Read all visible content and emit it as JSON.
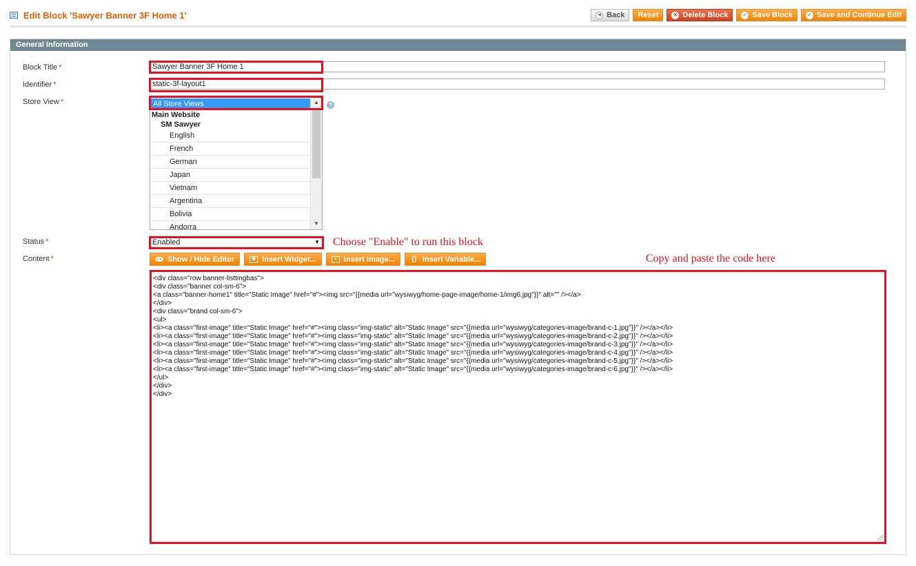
{
  "header": {
    "title": "Edit Block 'Sawyer Banner 3F Home 1'",
    "buttons": {
      "back": "Back",
      "reset": "Reset",
      "delete": "Delete Block",
      "save": "Save Block",
      "save_continue": "Save and Continue Edit"
    }
  },
  "section": {
    "title": "General Information"
  },
  "form": {
    "block_title": {
      "label": "Block Title",
      "required": "*",
      "value": "Sawyer Banner 3F Home 1"
    },
    "identifier": {
      "label": "Identifier",
      "required": "*",
      "value": "static-3f-layout1"
    },
    "store_view": {
      "label": "Store View",
      "required": "*",
      "selected": "All Store Views",
      "group_website": "Main Website",
      "group_store": "SM Sawyer",
      "options": [
        "English",
        "French",
        "German",
        "Japan",
        "Vietnam",
        "Argentina",
        "Bolivia",
        "Andorra"
      ]
    },
    "status": {
      "label": "Status",
      "required": "*",
      "value": "Enabled"
    },
    "content": {
      "label": "Content",
      "required": "*",
      "toolbar": {
        "show_hide": "Show / Hide Editor",
        "insert_widget": "Insert Widget...",
        "insert_image": "Insert Image...",
        "insert_variable": "Insert Variable..."
      },
      "code": "<div class=\"row banner-listtingbas\">\n<div class=\"banner col-sm-6\">\n<a class=\"banner-home1\" title=\"Static Image\" href=\"#\"><img src=\"{{media url=\"wysiwyg/home-page-image/home-1/img6.jpg\"}}\" alt=\"\" /></a>\n</div>\n<div class=\"brand col-sm-6\">\n<ul>\n<li><a class=\"first-image\" title=\"Static Image\" href=\"#\"><img class=\"img-static\" alt=\"Static Image\" src=\"{{media url=\"wysiwyg/categories-image/brand-c-1.jpg\"}}\" /></a></li>\n<li><a class=\"first-image\" title=\"Static Image\" href=\"#\"><img class=\"img-static\" alt=\"Static Image\" src=\"{{media url=\"wysiwyg/categories-image/brand-c-2.jpg\"}}\" /></a></li>\n<li><a class=\"first-image\" title=\"Static Image\" href=\"#\"><img class=\"img-static\" alt=\"Static Image\" src=\"{{media url=\"wysiwyg/categories-image/brand-c-3.jpg\"}}\" /></a></li>\n<li><a class=\"first-image\" title=\"Static Image\" href=\"#\"><img class=\"img-static\" alt=\"Static Image\" src=\"{{media url=\"wysiwyg/categories-image/brand-c-4.jpg\"}}\" /></a></li>\n<li><a class=\"first-image\" title=\"Static Image\" href=\"#\"><img class=\"img-static\" alt=\"Static Image\" src=\"{{media url=\"wysiwyg/categories-image/brand-c-5.jpg\"}}\" /></a></li>\n<li><a class=\"first-image\" title=\"Static Image\" href=\"#\"><img class=\"img-static\" alt=\"Static Image\" src=\"{{media url=\"wysiwyg/categories-image/brand-c-6.jpg\"}}\" /></a></li>\n</ul>\n</div>\n</div>"
    }
  },
  "annotations": {
    "status_note": "Choose \"Enable\" to run this block",
    "content_note": "Copy and paste the code here"
  },
  "colors": {
    "accent": "#eb5e00",
    "button_orange": "#f18200",
    "annotation_red": "#e8101e",
    "section_header": "#6f8992",
    "selected_option": "#3399ff"
  }
}
